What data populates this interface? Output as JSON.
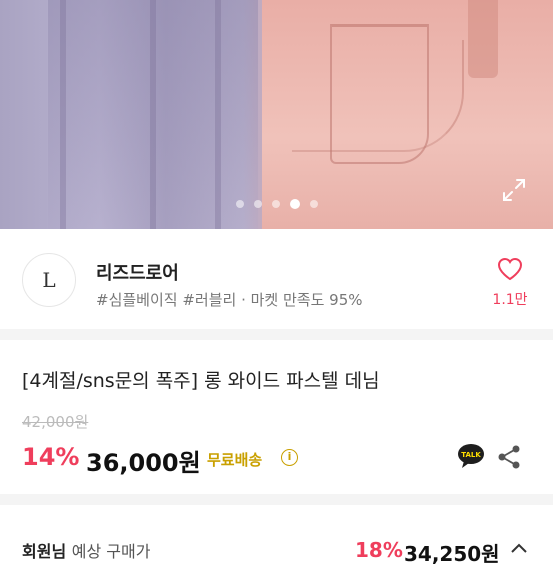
{
  "gallery": {
    "dot_count": 5,
    "active_index": 3
  },
  "seller": {
    "avatar_text": "L",
    "name": "리즈드로어",
    "meta": "#심플베이직 #러블리 · 마켓 만족도 95%",
    "like_count": "1.1만"
  },
  "product": {
    "title": "[4계절/sns문의 폭주] 롱 와이드 파스텔 데님",
    "original_price": "42,000원",
    "discount_rate": "14%",
    "price": "36,000원",
    "shipping": "무료배송",
    "talk_label": "TALK"
  },
  "member_price": {
    "label": "회원님",
    "sub_label": "예상 구매가",
    "discount_rate": "18%",
    "price": "34,250원"
  },
  "colors": {
    "accent": "#ef3e5c",
    "shipping": "#c9a000",
    "talk_bg": "#1e1e1e",
    "talk_fg": "#ffde00"
  }
}
